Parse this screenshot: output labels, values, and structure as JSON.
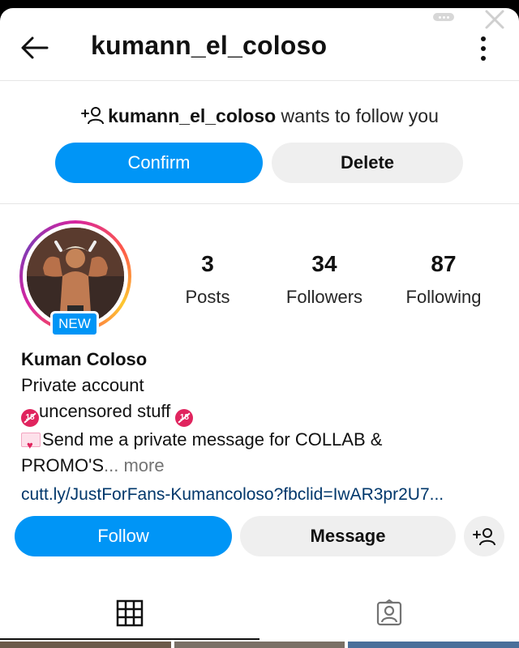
{
  "header": {
    "username": "kumann_el_coloso"
  },
  "request": {
    "username": "kumann_el_coloso",
    "text": " wants to follow you",
    "confirm_label": "Confirm",
    "delete_label": "Delete"
  },
  "profile": {
    "badge": "NEW",
    "stats": [
      {
        "value": "3",
        "label": "Posts"
      },
      {
        "value": "34",
        "label": "Followers"
      },
      {
        "value": "87",
        "label": "Following"
      }
    ],
    "name": "Kuman Coloso",
    "bio_line1": "Private account",
    "bio_line2": "uncensored stuff ",
    "bio_line3a": "Send me a private message for COLLAB &",
    "bio_line3b": "PROMO'S",
    "more": "... more",
    "link": "cutt.ly/JustForFans-Kumancoloso?fbclid=IwAR3pr2U7..."
  },
  "actions": {
    "follow_label": "Follow",
    "message_label": "Message"
  },
  "tabs": [
    {
      "icon": "grid-icon",
      "selected": true
    },
    {
      "icon": "tagged-icon",
      "selected": false
    }
  ],
  "colors": {
    "primary": "#0095f6",
    "secondary_button": "#efefef",
    "link": "#00376b"
  }
}
